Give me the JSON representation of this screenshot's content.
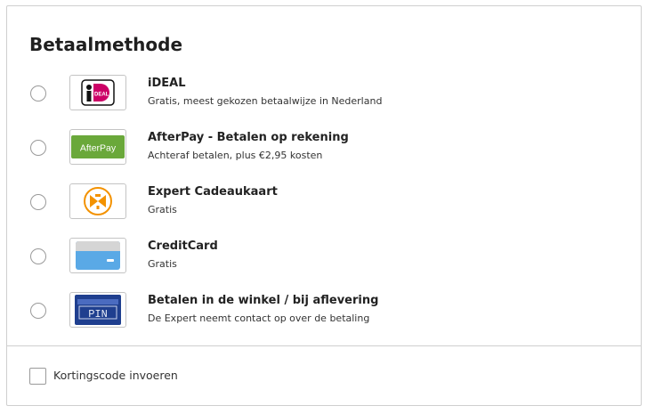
{
  "section": {
    "title": "Betaalmethode"
  },
  "methods": [
    {
      "name": "iDEAL",
      "description": "Gratis, meest gekozen betaalwijze in Nederland",
      "icon": "ideal-logo-icon"
    },
    {
      "name": "AfterPay - Betalen op rekening",
      "description": "Achteraf betalen, plus €2,95 kosten",
      "icon": "afterpay-logo-icon",
      "logo_text": "AfterPay"
    },
    {
      "name": "Expert Cadeaukaart",
      "description": "Gratis",
      "icon": "expert-giftcard-icon"
    },
    {
      "name": "CreditCard",
      "description": "Gratis",
      "icon": "creditcard-icon"
    },
    {
      "name": "Betalen in de winkel / bij aflevering",
      "description": "De Expert neemt contact op over de betaling",
      "icon": "pin-card-icon",
      "logo_text": "PIN"
    }
  ],
  "coupon": {
    "label": "Kortingscode invoeren"
  },
  "colors": {
    "afterpay_green": "#6aa83a",
    "ideal_pink": "#cc0066",
    "expert_orange": "#f39200",
    "creditcard_blue": "#5aa9e6",
    "pin_blue": "#1f3f8f"
  }
}
